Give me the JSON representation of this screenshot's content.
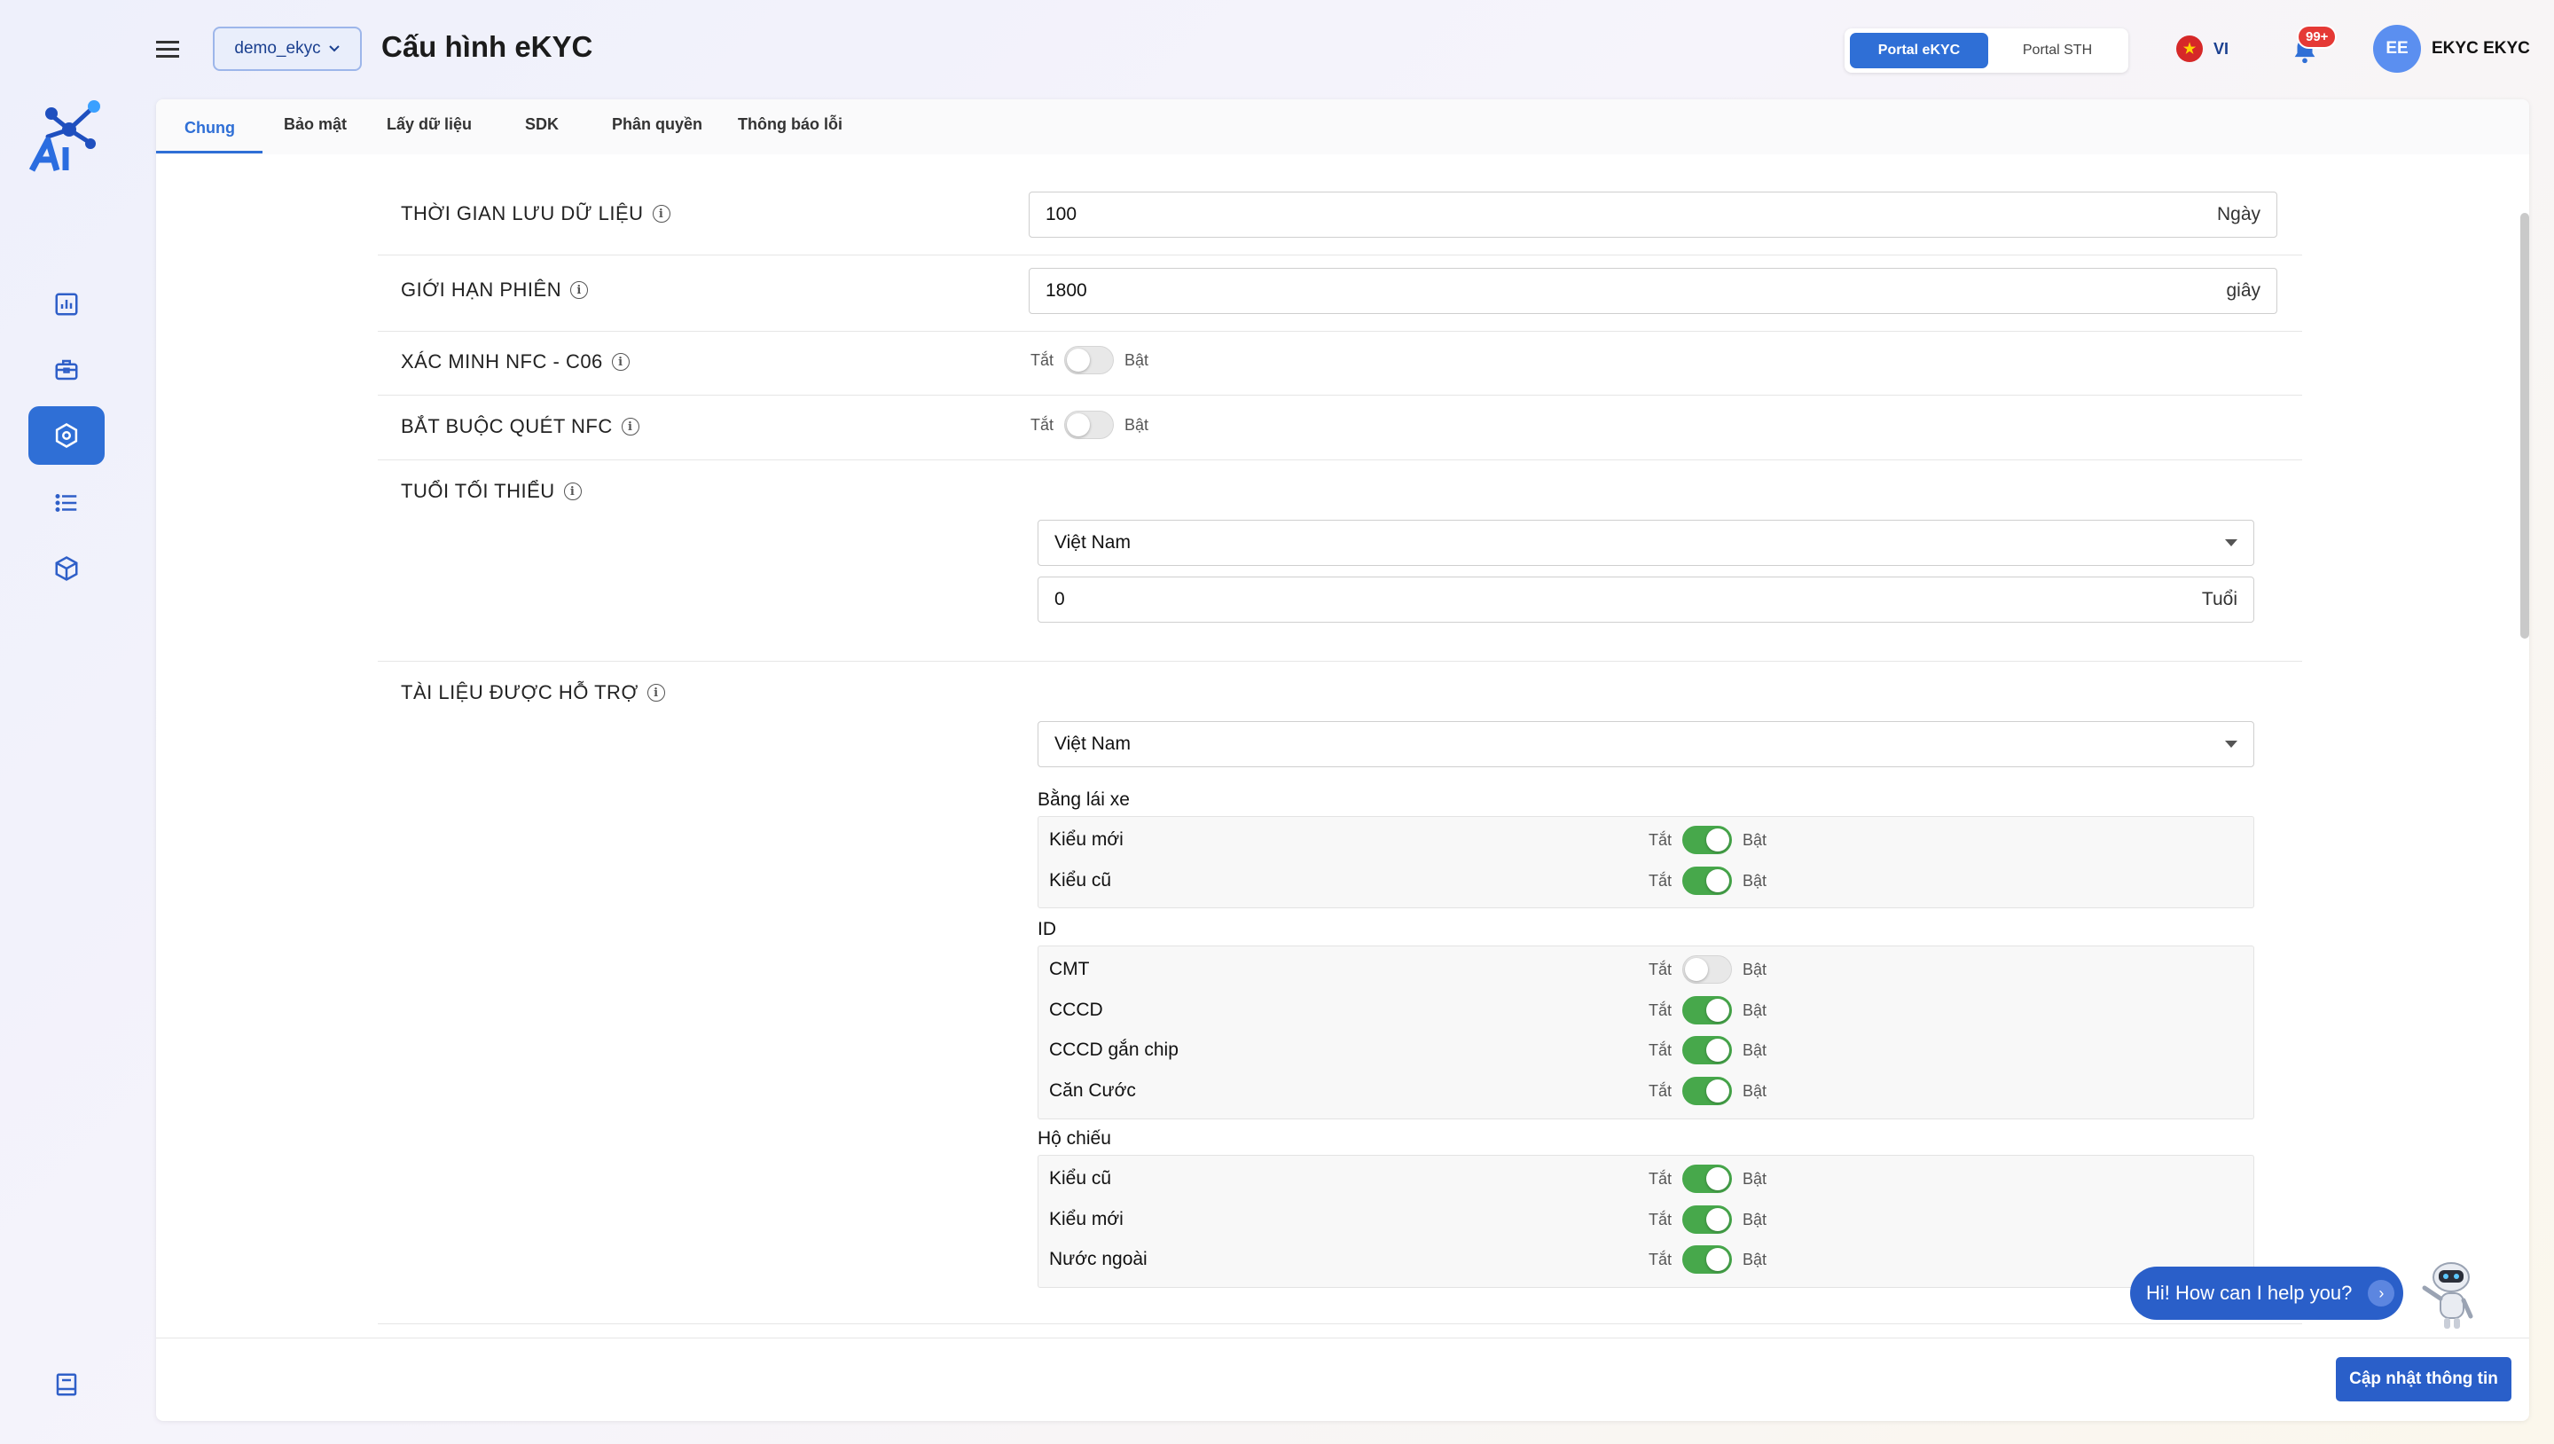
{
  "header": {
    "tenant": "demo_ekyc",
    "page_title": "Cấu hình eKYC",
    "portal_active": "Portal eKYC",
    "portal_other": "Portal STH",
    "language": "VI",
    "notification_badge": "99+",
    "avatar_initials": "EE",
    "username": "EKYC EKYC"
  },
  "sidebar": {
    "items": [
      "dashboard-icon",
      "briefcase-icon",
      "settings-icon",
      "list-icon",
      "package-icon",
      "book-icon"
    ]
  },
  "tabs": [
    "Chung",
    "Bảo mật",
    "Lấy dữ liệu",
    "SDK",
    "Phân quyền",
    "Thông báo lỗi"
  ],
  "settings": {
    "retention": {
      "label": "THỜI GIAN LƯU DỮ LIỆU",
      "value": "100",
      "unit": "Ngày"
    },
    "session": {
      "label": "GIỚI HẠN PHIÊN",
      "value": "1800",
      "unit": "giây"
    },
    "nfc_c06": {
      "label": "XÁC MINH NFC - C06",
      "off": "Tắt",
      "on": "Bật",
      "enabled": false
    },
    "nfc_required": {
      "label": "BẮT BUỘC QUÉT NFC",
      "off": "Tắt",
      "on": "Bật",
      "enabled": false
    },
    "min_age": {
      "label": "TUỔI TỐI THIỂU",
      "country": "Việt Nam",
      "value": "0",
      "unit": "Tuổi"
    },
    "docs": {
      "label": "TÀI LIỆU ĐƯỢC HỖ TRỢ",
      "country": "Việt Nam",
      "off": "Tắt",
      "on": "Bật",
      "groups": [
        {
          "title": "Bằng lái xe",
          "items": [
            {
              "name": "Kiểu mới",
              "enabled": true
            },
            {
              "name": "Kiểu cũ",
              "enabled": true
            }
          ]
        },
        {
          "title": "ID",
          "items": [
            {
              "name": "CMT",
              "enabled": false
            },
            {
              "name": "CCCD",
              "enabled": true
            },
            {
              "name": "CCCD gắn chip",
              "enabled": true
            },
            {
              "name": "Căn Cước",
              "enabled": true
            }
          ]
        },
        {
          "title": "Hộ chiếu",
          "items": [
            {
              "name": "Kiểu cũ",
              "enabled": true
            },
            {
              "name": "Kiểu mới",
              "enabled": true
            },
            {
              "name": "Nước ngoài",
              "enabled": true
            }
          ]
        }
      ]
    }
  },
  "footer": {
    "update_label": "Cập nhật thông tin"
  },
  "chat": {
    "prompt": "Hi! How can I help you?"
  },
  "colors": {
    "primary": "#2f6fd6",
    "toggle_on": "#47a84b"
  }
}
